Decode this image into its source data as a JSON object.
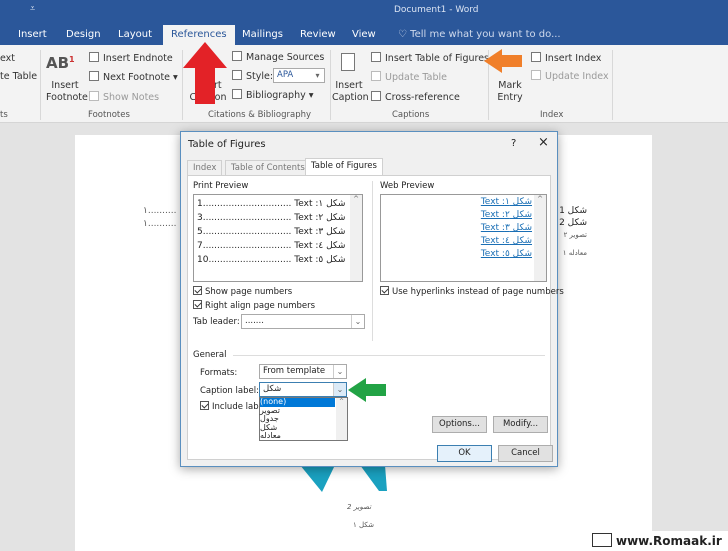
{
  "window": {
    "title": "Document1 - Word",
    "qat_icon": "customize-qat-icon"
  },
  "tabs": [
    {
      "label": "Insert"
    },
    {
      "label": "Design"
    },
    {
      "label": "Layout"
    },
    {
      "label": "References",
      "active": true
    },
    {
      "label": "Mailings"
    },
    {
      "label": "Review"
    },
    {
      "label": "View"
    }
  ],
  "tell_me": "Tell me what you want to do...",
  "ribbon": {
    "toc": {
      "text_label": "ext",
      "update_table": "te Table",
      "group": "ts"
    },
    "footnotes": {
      "insert_footnote": "Insert Footnote",
      "insert_endnote": "Insert Endnote",
      "next_footnote": "Next Footnote",
      "show_notes": "Show Notes",
      "group": "Footnotes"
    },
    "citations": {
      "insert_citation": "Insert Citation",
      "manage_sources": "Manage Sources",
      "style_label": "Style:",
      "style_value": "APA",
      "bibliography": "Bibliography",
      "group": "Citations & Bibliography"
    },
    "captions": {
      "insert_caption": "Insert Caption",
      "insert_tof": "Insert Table of Figures",
      "update_table": "Update Table",
      "cross_reference": "Cross-reference",
      "group": "Captions"
    },
    "index": {
      "mark_entry": "Mark Entry",
      "insert_index": "Insert Index",
      "update_index": "Update Index",
      "group": "Index"
    }
  },
  "annotations": {
    "red_arrow": "#e32227",
    "orange_arrow": "#f07f2a",
    "green_arrow": "#22a345"
  },
  "document": {
    "left_lines": [
      "١..........",
      "١.........."
    ],
    "right_lines": [
      "شکل 1",
      "شکل 2",
      "تصویر ۲",
      "معادله ۱"
    ],
    "caption1": "تصویر 2",
    "caption2": "شکل ۱"
  },
  "dialog": {
    "title": "Table of Figures",
    "help": "?",
    "close": "×",
    "tabs": [
      "Index",
      "Table of Contents",
      "Table of Figures"
    ],
    "print_preview": {
      "label": "Print Preview",
      "rows": [
        "1............................... Text :شکل ۱",
        "3............................... Text :شکل ۲",
        "5............................... Text :شکل ۳",
        "7............................... Text :شکل ٤",
        "10............................. Text :شکل ٥"
      ]
    },
    "show_page_numbers": "Show page numbers",
    "right_align": "Right align page numbers",
    "tab_leader_label": "Tab leader:",
    "tab_leader_value": ".......",
    "web_preview": {
      "label": "Web Preview",
      "rows": [
        "Text :شکل ۱",
        "Text :شکل ۲",
        "Text :شکل ۳",
        "Text :شکل ٤",
        "Text :شکل ٥"
      ]
    },
    "use_hyperlinks": "Use hyperlinks instead of page numbers",
    "general": "General",
    "formats_label": "Formats:",
    "formats_value": "From template",
    "caption_label": "Caption label:",
    "caption_value": "شکل",
    "caption_options": [
      "(none)",
      "تصویر",
      "جدول",
      "شکل",
      "معادله"
    ],
    "include_label": "Include labe",
    "options": "Options...",
    "modify": "Modify...",
    "ok": "OK",
    "cancel": "Cancel"
  },
  "watermark": "www.Romaak.ir"
}
